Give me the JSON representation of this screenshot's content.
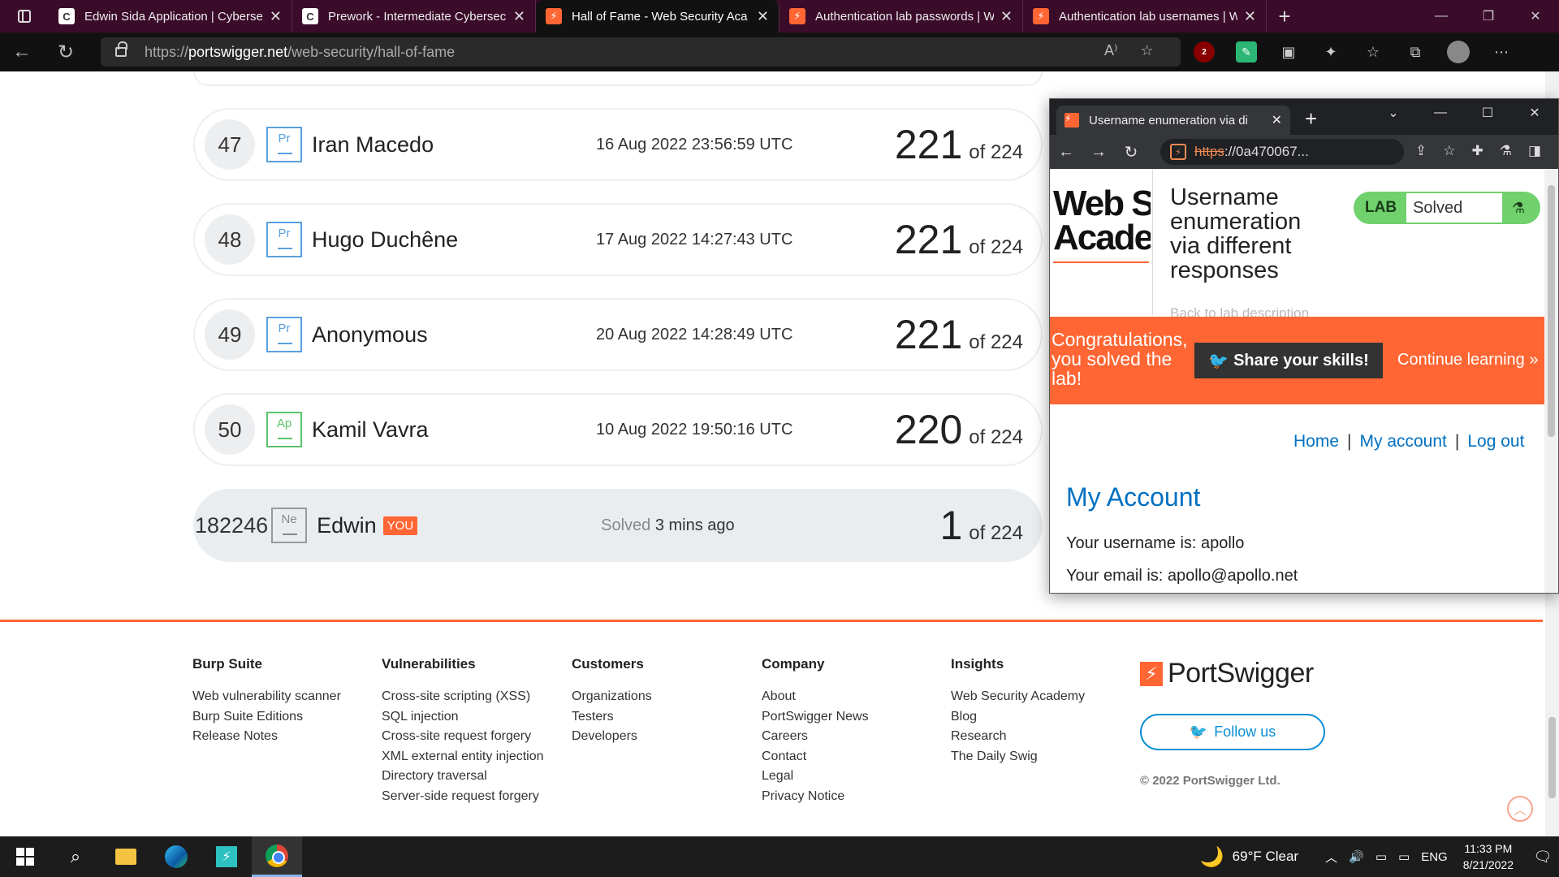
{
  "browser": {
    "tabs": [
      {
        "title": "Edwin Sida Application | Cyberse",
        "favicon": "C",
        "active": false
      },
      {
        "title": "Prework - Intermediate Cybersec",
        "favicon": "C",
        "active": false
      },
      {
        "title": "Hall of Fame - Web Security Aca",
        "favicon": "⚡",
        "active": true
      },
      {
        "title": "Authentication lab passwords | W",
        "favicon": "⚡",
        "active": false
      },
      {
        "title": "Authentication lab usernames | W",
        "favicon": "⚡",
        "active": false
      }
    ],
    "url_prefix": "https://",
    "url_host": "portswigger.net",
    "url_path": "/web-security/hall-of-fame",
    "ublock_count": "2"
  },
  "leaderboard": [
    {
      "rank": "47",
      "level": "Pr",
      "name": "Iran Macedo",
      "date": "16 Aug 2022 23:56:59 UTC",
      "score": "221",
      "of": "of 224"
    },
    {
      "rank": "48",
      "level": "Pr",
      "name": "Hugo Duchêne",
      "date": "17 Aug 2022 14:27:43 UTC",
      "score": "221",
      "of": "of 224"
    },
    {
      "rank": "49",
      "level": "Pr",
      "name": "Anonymous",
      "date": "20 Aug 2022 14:28:49 UTC",
      "score": "221",
      "of": "of 224"
    },
    {
      "rank": "50",
      "level": "Ap",
      "name": "Kamil Vavra",
      "date": "10 Aug 2022 19:50:16 UTC",
      "score": "220",
      "of": "of 224"
    }
  ],
  "you_row": {
    "rank": "182246",
    "level": "Ne",
    "name": "Edwin",
    "badge": "YOU",
    "solved_prefix": "Solved",
    "solved_time": "3 mins ago",
    "score": "1",
    "of": "of 224"
  },
  "footer": {
    "columns": [
      {
        "heading": "Burp Suite",
        "links": [
          "Web vulnerability scanner",
          "Burp Suite Editions",
          "Release Notes"
        ]
      },
      {
        "heading": "Vulnerabilities",
        "links": [
          "Cross-site scripting (XSS)",
          "SQL injection",
          "Cross-site request forgery",
          "XML external entity injection",
          "Directory traversal",
          "Server-side request forgery"
        ]
      },
      {
        "heading": "Customers",
        "links": [
          "Organizations",
          "Testers",
          "Developers"
        ]
      },
      {
        "heading": "Company",
        "links": [
          "About",
          "PortSwigger News",
          "Careers",
          "Contact",
          "Legal",
          "Privacy Notice"
        ]
      },
      {
        "heading": "Insights",
        "links": [
          "Web Security Academy",
          "Blog",
          "Research",
          "The Daily Swig"
        ]
      }
    ],
    "brand": "PortSwigger",
    "follow_label": "Follow us",
    "copyright": "© 2022 PortSwigger Ltd."
  },
  "popup": {
    "tab_title": "Username enumeration via di",
    "url_https": "https",
    "url_rest": "://0a470067...",
    "logo_line1": "Web Se",
    "logo_line2": "Acader",
    "lab_title": "Username enumeration via different responses",
    "lab_label": "LAB",
    "lab_status": "Solved",
    "back_link": "Back to lab description",
    "congrats": "Congratulations, you solved the lab!",
    "share": "Share your skills!",
    "continue": "Continue learning",
    "nav": {
      "home": "Home",
      "my_account": "My account",
      "logout": "Log out"
    },
    "heading": "My Account",
    "username_line": "Your username is: apollo",
    "email_line": "Your email is: apollo@apollo.net"
  },
  "taskbar": {
    "weather": "69°F  Clear",
    "lang": "ENG",
    "time": "11:33 PM",
    "date": "8/21/2022"
  },
  "colors": {
    "accent": "#ff6633",
    "lab_solved": "#70d16d",
    "link": "#0070c0"
  }
}
